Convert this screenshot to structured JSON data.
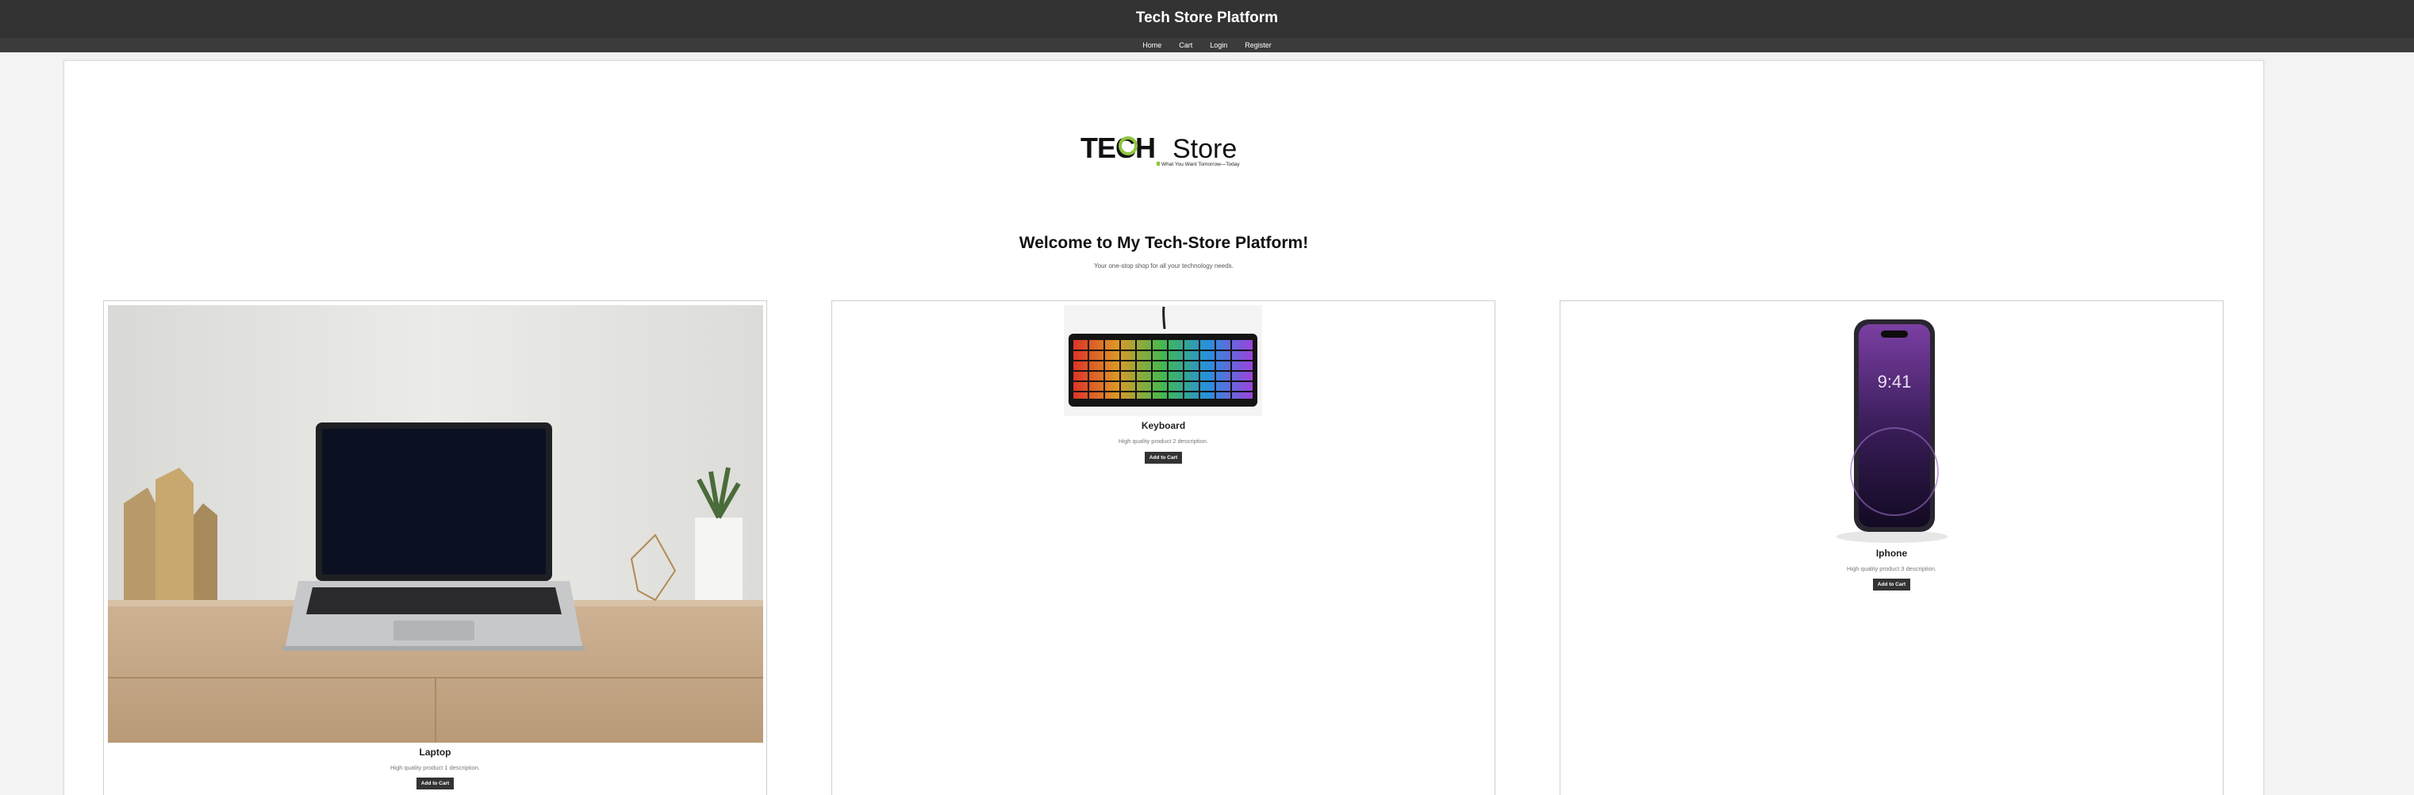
{
  "header": {
    "title": "Tech Store Platform"
  },
  "nav": {
    "items": [
      "Home",
      "Cart",
      "Login",
      "Register"
    ]
  },
  "logo": {
    "text_tech": "TECH",
    "text_store": "Store",
    "tagline": "What You Want Tomorrow—Today"
  },
  "hero": {
    "heading": "Welcome to My Tech-Store Platform!",
    "subheading": "Your one-stop shop for all your technology needs."
  },
  "products": [
    {
      "name": "Laptop",
      "description": "High quality product 1 description.",
      "button": "Add to Cart",
      "image": "laptop-image"
    },
    {
      "name": "Keyboard",
      "description": "High quality product 2 description.",
      "button": "Add to Cart",
      "image": "keyboard-image"
    },
    {
      "name": "Iphone",
      "description": "High quality product 3 description.",
      "button": "Add to Cart",
      "image": "iphone-image"
    }
  ],
  "colors": {
    "header_bg": "#333333",
    "button_bg": "#333333",
    "page_bg": "#f3f3f3",
    "logo_accent": "#8dc63f"
  }
}
